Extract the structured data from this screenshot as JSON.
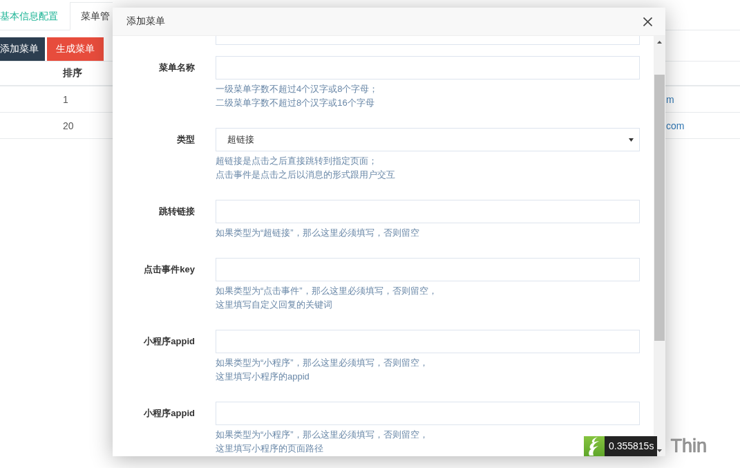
{
  "tabs": [
    {
      "label": "基本信息配置",
      "selected": false
    },
    {
      "label": "菜单管",
      "selected": true
    }
  ],
  "toolbar": {
    "buttons": [
      {
        "label": "添加菜单",
        "kind": "add"
      },
      {
        "label": "生成菜单",
        "kind": "generate"
      }
    ]
  },
  "table": {
    "header": {
      "column_2": "排序"
    },
    "rows": [
      {
        "column_2": "1",
        "column_3": "m"
      },
      {
        "column_2": "20",
        "column_3": "com"
      }
    ]
  },
  "dialog": {
    "title": "添加菜单",
    "fields": [
      {
        "label": "菜单名称",
        "kind": "text",
        "help": [
          "一级菜单字数不超过4个汉字或8个字母；",
          "二级菜单字数不超过8个汉字或16个字母"
        ]
      },
      {
        "label": "类型",
        "kind": "select",
        "value": "超链接",
        "help": [
          "超链接是点击之后直接跳转到指定页面；",
          "点击事件是点击之后以消息的形式跟用户交互"
        ]
      },
      {
        "label": "跳转链接",
        "kind": "text",
        "help": [
          "如果类型为“超链接”，那么这里必须填写，否则留空"
        ]
      },
      {
        "label": "点击事件key",
        "kind": "text",
        "help": [
          "如果类型为“点击事件”，那么这里必须填写，否则留空，",
          "这里填写自定义回复的关键词"
        ]
      },
      {
        "label": "小程序appid",
        "kind": "text",
        "help": [
          "如果类型为“小程序”，那么这里必须填写，否则留空，",
          "这里填写小程序的appid"
        ]
      },
      {
        "label": "小程序appid",
        "kind": "text",
        "help": [
          "如果类型为“小程序”，那么这里必须填写，否则留空，",
          "这里填写小程序的页面路径"
        ]
      }
    ]
  },
  "trace": {
    "time": "0.355815s",
    "brand": "Thin"
  }
}
